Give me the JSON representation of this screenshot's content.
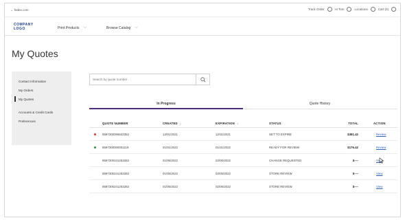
{
  "utility_bar": {
    "left_link": "← fedex.com",
    "track_order": "Track Order",
    "account": "Hi Tom",
    "locations": "Locations",
    "cart": "Cart (0)"
  },
  "nav": {
    "logo_line1": "COMPANY",
    "logo_line2": "LOGO",
    "print_products": "Print Products",
    "browse_catalog": "Browse Catalog"
  },
  "page_title": "My Quotes",
  "sidebar": {
    "items": [
      {
        "label": "Contact Information"
      },
      {
        "label": "My Orders"
      },
      {
        "label": "My Quotes",
        "active": true
      },
      {
        "label": "Accounts & Credit Cards"
      },
      {
        "label": "Preferences"
      }
    ]
  },
  "search": {
    "placeholder": "Search by quote number"
  },
  "tabs": {
    "in_progress": "In Progress",
    "quote_history": "Quote History"
  },
  "table": {
    "headers": {
      "quote_number": "QUOTE NUMBER",
      "created": "CREATED",
      "expiration": "EXPIRATION",
      "status": "STATUS",
      "total": "TOTAL",
      "action": "ACTION"
    },
    "rows": [
      {
        "indicator": "#d9342b",
        "quote_number": "8597300006643352",
        "created": "12/01/2021",
        "expiration": "12/31/2021",
        "status": "SET TO EXPIRE",
        "total": "$381.42",
        "action": "Review"
      },
      {
        "indicator": "#2e8b3e",
        "quote_number": "8597300000001119",
        "created": "01/01/2022",
        "expiration": "01/31/2022",
        "status": "READY FOR REVIEW",
        "total": "$176.42",
        "action": "Review"
      },
      {
        "indicator": "",
        "quote_number": "8597300241253282",
        "created": "01/05/2022",
        "expiration": "02/05/2022",
        "status": "CHANGE REQUESTED",
        "total": "$----",
        "action": "View"
      },
      {
        "indicator": "",
        "quote_number": "8597300241253282",
        "created": "01/05/2022",
        "expiration": "02/05/2022",
        "status": "STORE REVIEW",
        "total": "$----",
        "action": "View"
      },
      {
        "indicator": "",
        "quote_number": "8597300241253282",
        "created": "01/05/2022",
        "expiration": "02/05/2022",
        "status": "STORE REVIEW",
        "total": "$----",
        "action": "View"
      }
    ]
  }
}
